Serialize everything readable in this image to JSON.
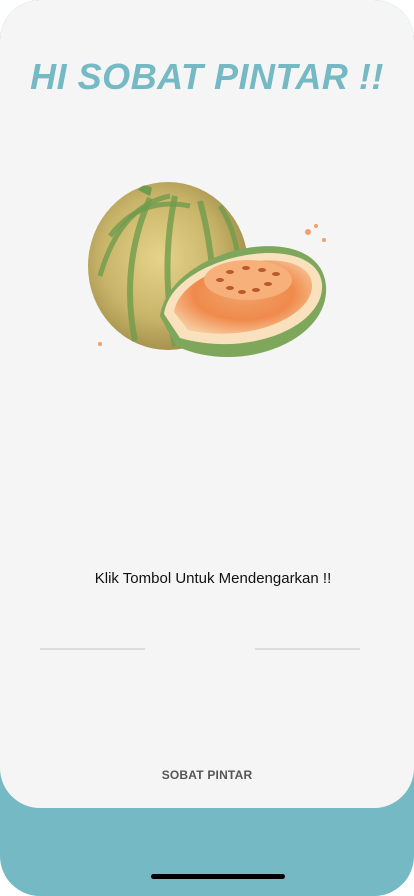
{
  "header": {
    "title": "HI SOBAT PINTAR !!"
  },
  "main": {
    "image_icon": "cantaloupe-melon-icon",
    "instruction": "Klik Tombol Untuk Mendengarkan !!"
  },
  "footer": {
    "brand": "SOBAT PINTAR"
  },
  "colors": {
    "accent": "#74b9c4",
    "card": "#f5f5f5",
    "text": "#111111"
  }
}
